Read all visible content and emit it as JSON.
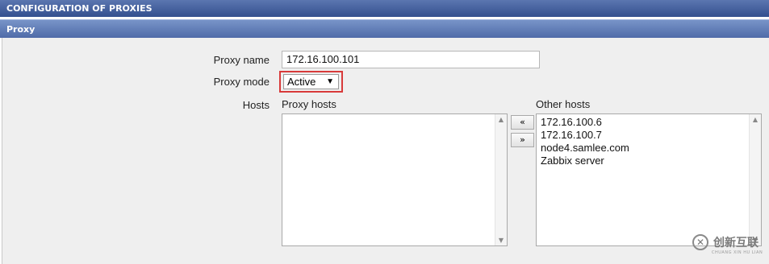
{
  "header": {
    "title": "CONFIGURATION OF PROXIES"
  },
  "form": {
    "section_title": "Proxy",
    "proxy_name_label": "Proxy name",
    "proxy_name_value": "172.16.100.101",
    "proxy_mode_label": "Proxy mode",
    "proxy_mode_value": "Active",
    "hosts_label": "Hosts",
    "proxy_hosts_title": "Proxy hosts",
    "other_hosts_title": "Other hosts",
    "proxy_hosts": [],
    "other_hosts": [
      "172.16.100.6",
      "172.16.100.7",
      "node4.samlee.com",
      "Zabbix server"
    ],
    "move_left_label": "«",
    "move_right_label": "»"
  },
  "watermark": {
    "text_cn": "创新互联",
    "text_en": "CHUANG XIN HU LIAN",
    "icon": "brand-logo-icon"
  },
  "colors": {
    "header_bg": "#3e5a98",
    "subheader_bg": "#5d79b6",
    "highlight_border": "#d83a3a",
    "panel_bg": "#efefef"
  }
}
